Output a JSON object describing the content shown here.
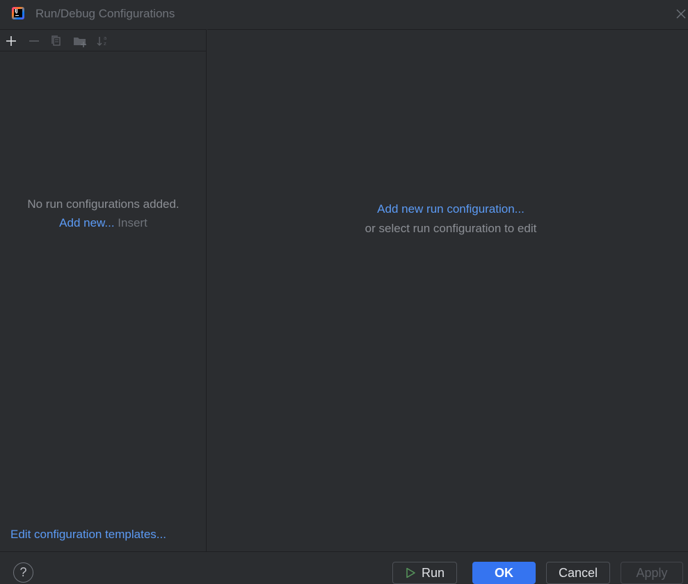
{
  "window": {
    "title": "Run/Debug Configurations",
    "app_icon": "intellij-idea-icon",
    "close_icon": "close-icon"
  },
  "toolbar": {
    "buttons": [
      {
        "name": "add-icon",
        "tooltip": "Add New Configuration"
      },
      {
        "name": "remove-icon",
        "tooltip": "Remove Configuration"
      },
      {
        "name": "copy-icon",
        "tooltip": "Copy Configuration"
      },
      {
        "name": "new-folder-icon",
        "tooltip": "Create New Folder"
      },
      {
        "name": "sort-alphabetically-icon",
        "tooltip": "Sort Configurations"
      }
    ]
  },
  "left_panel": {
    "empty_message": "No run configurations added.",
    "add_new_link": "Add new...",
    "add_new_shortcut": "Insert",
    "templates_link": "Edit configuration templates..."
  },
  "right_panel": {
    "add_link": "Add new run configuration...",
    "sub_text": "or select run configuration to edit"
  },
  "footer": {
    "help_label": "?",
    "run_label": "Run",
    "ok_label": "OK",
    "cancel_label": "Cancel",
    "apply_label": "Apply"
  },
  "colors": {
    "background": "#2b2d30",
    "link": "#5c9bf5",
    "primary_button": "#3574f0",
    "run_icon": "#57965c"
  }
}
